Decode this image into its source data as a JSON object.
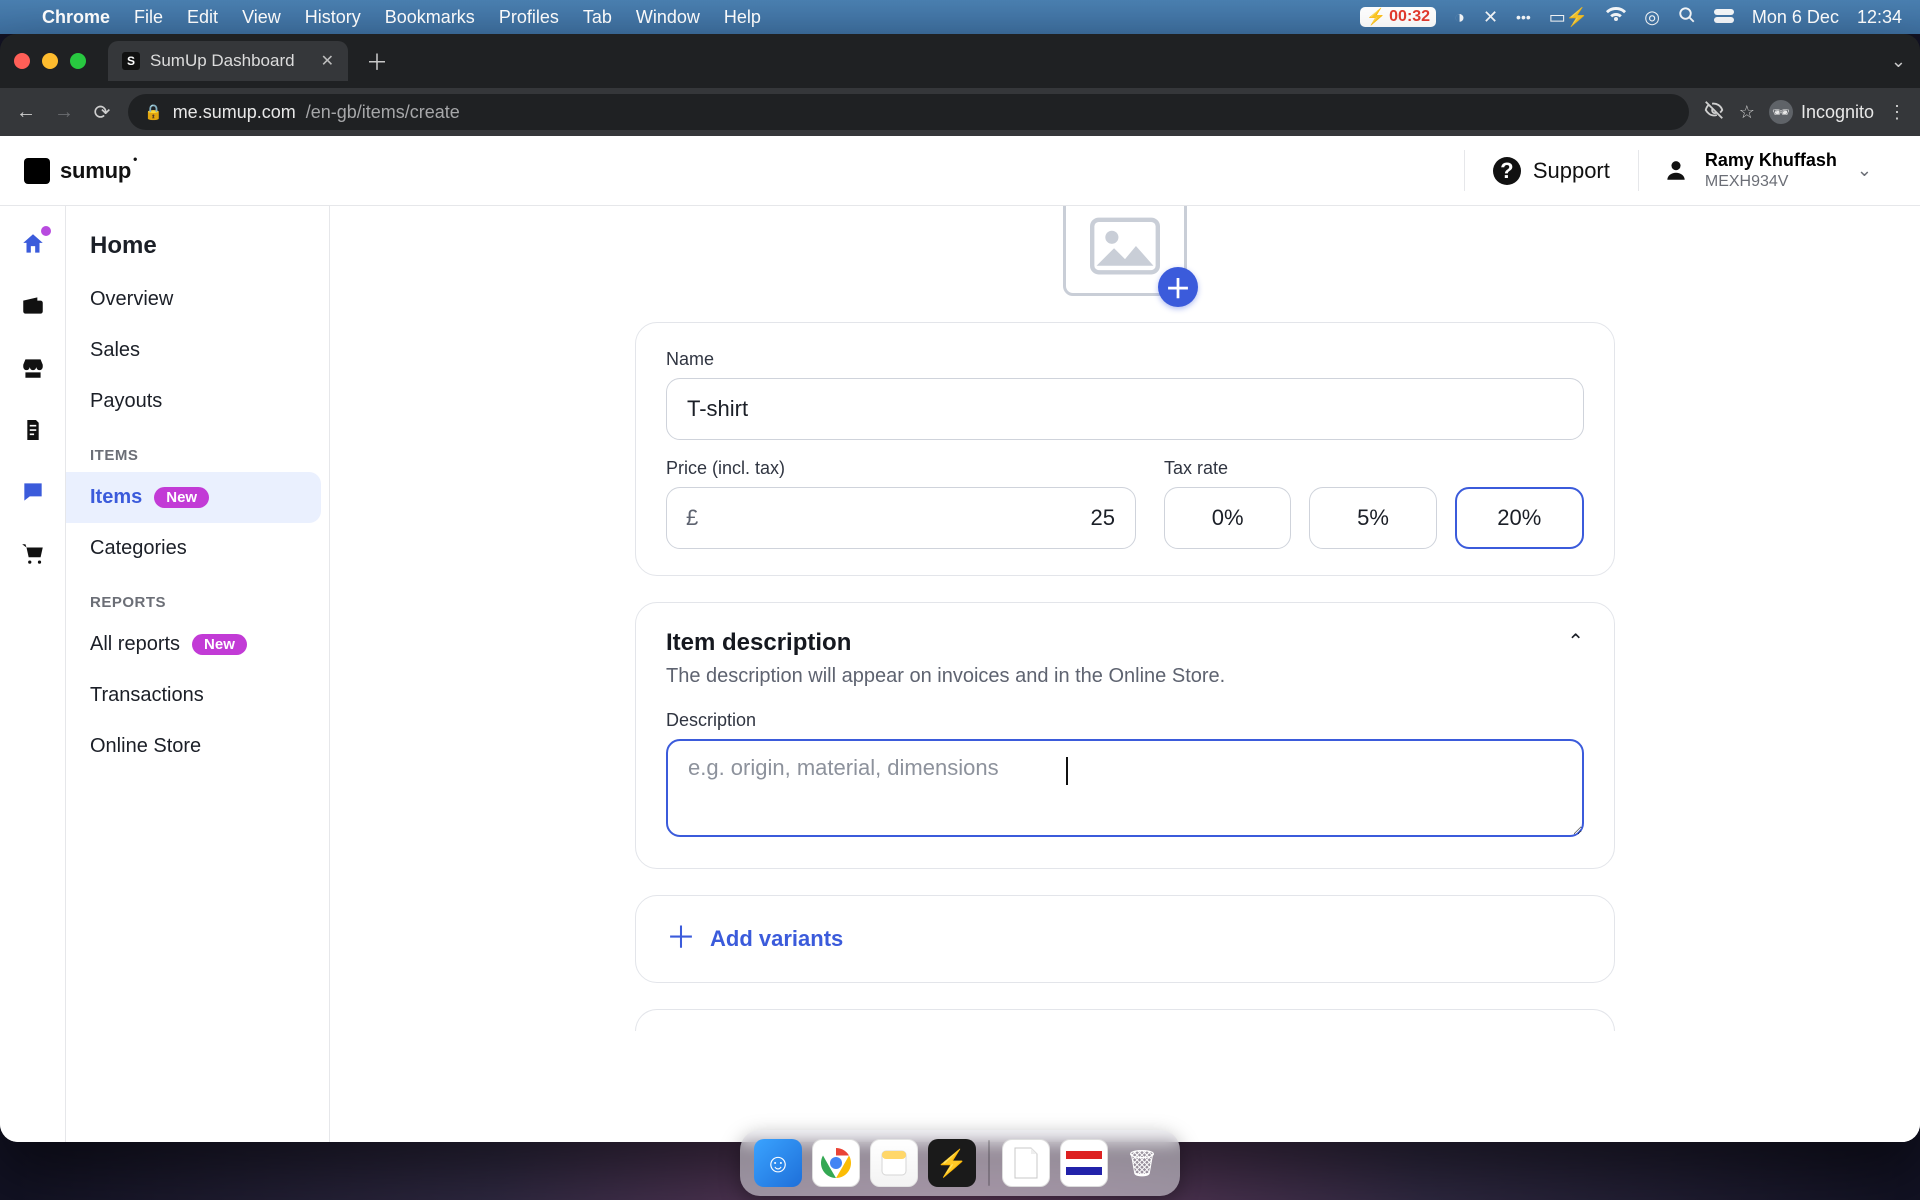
{
  "mac": {
    "app": "Chrome",
    "menus": [
      "File",
      "Edit",
      "View",
      "History",
      "Bookmarks",
      "Profiles",
      "Tab",
      "Window",
      "Help"
    ],
    "battery_time": "00:32",
    "date": "Mon 6 Dec",
    "clock": "12:34"
  },
  "browser": {
    "tab_title": "SumUp Dashboard",
    "url_host": "me.sumup.com",
    "url_path": "/en-gb/items/create",
    "incognito": "Incognito"
  },
  "header": {
    "brand": "sumup",
    "support": "Support",
    "user_name": "Ramy Khuffash",
    "user_code": "MEXH934V"
  },
  "nav": {
    "home": "Home",
    "items": [
      "Overview",
      "Sales",
      "Payouts"
    ],
    "group_items": "ITEMS",
    "items_link": "Items",
    "new_pill": "New",
    "categories": "Categories",
    "group_reports": "REPORTS",
    "all_reports": "All reports",
    "transactions": "Transactions",
    "online_store": "Online Store"
  },
  "form": {
    "name_label": "Name",
    "name_value": "T-shirt",
    "price_label": "Price (incl. tax)",
    "currency": "£",
    "price_value": "25",
    "tax_label": "Tax rate",
    "tax_options": [
      "0%",
      "5%",
      "20%"
    ],
    "tax_selected": "20%",
    "desc_heading": "Item description",
    "desc_help": "The description will appear on invoices and in the Online Store.",
    "desc_label": "Description",
    "desc_placeholder": "e.g. origin, material, dimensions",
    "add_variants": "Add variants"
  }
}
